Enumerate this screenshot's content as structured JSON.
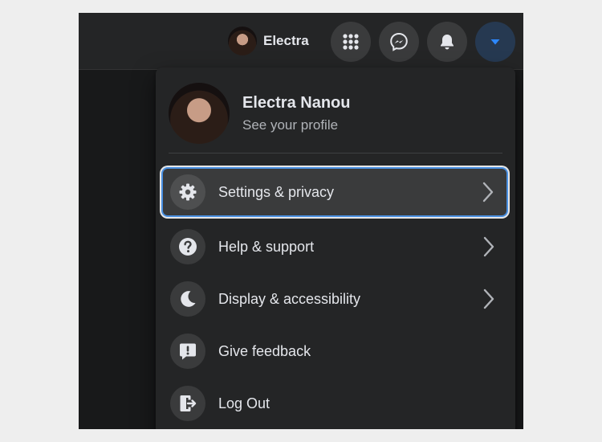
{
  "header": {
    "user_name": "Electra",
    "icons": [
      "menu-grid-icon",
      "messenger-icon",
      "bell-icon",
      "caret-down-icon"
    ]
  },
  "menu": {
    "profile": {
      "name": "Electra Nanou",
      "subtitle": "See your profile"
    },
    "items": [
      {
        "label": "Settings & privacy",
        "icon": "gear-icon",
        "has_chevron": true,
        "focused": true
      },
      {
        "label": "Help & support",
        "icon": "question-icon",
        "has_chevron": true
      },
      {
        "label": "Display & accessibility",
        "icon": "moon-icon",
        "has_chevron": true
      },
      {
        "label": "Give feedback",
        "icon": "feedback-icon",
        "has_chevron": false
      },
      {
        "label": "Log Out",
        "icon": "logout-icon",
        "has_chevron": false
      }
    ]
  },
  "colors": {
    "background": "#18191a",
    "surface": "#242526",
    "icon_bg": "#3a3b3c",
    "text": "#e4e6eb",
    "secondary_text": "#b0b3b8",
    "accent": "#2d88ff",
    "focus_ring": "#4a90e2"
  }
}
